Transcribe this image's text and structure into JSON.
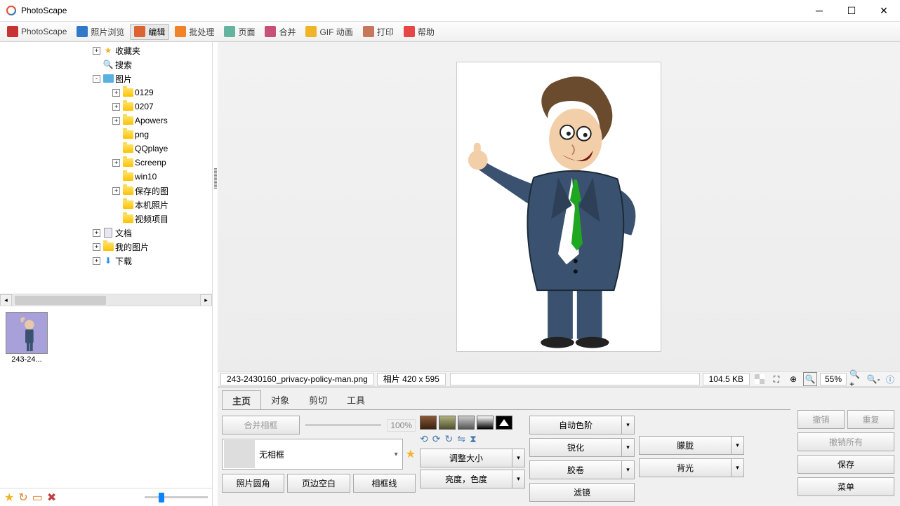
{
  "app": {
    "title": "PhotoScape"
  },
  "toolbar": {
    "items": [
      {
        "label": "PhotoScape",
        "ico": "#c83232",
        "active": false
      },
      {
        "label": "照片浏览",
        "ico": "#3278c8",
        "active": false
      },
      {
        "label": "编辑",
        "ico": "#dc6432",
        "active": true
      },
      {
        "label": "批处理",
        "ico": "#f08228",
        "active": false
      },
      {
        "label": "页面",
        "ico": "#64b4a0",
        "active": false
      },
      {
        "label": "合并",
        "ico": "#c85078",
        "active": false
      },
      {
        "label": "GIF 动画",
        "ico": "#f0b428",
        "active": false
      },
      {
        "label": "打印",
        "ico": "#c8785a",
        "active": false
      },
      {
        "label": "帮助",
        "ico": "#e64646",
        "active": false
      }
    ]
  },
  "tree": {
    "items": [
      {
        "indent": 132,
        "exp": "+",
        "icon": "star",
        "label": "收藏夹"
      },
      {
        "indent": 132,
        "exp": "",
        "icon": "search",
        "label": "搜索"
      },
      {
        "indent": 132,
        "exp": "-",
        "icon": "pics",
        "label": "图片"
      },
      {
        "indent": 160,
        "exp": "+",
        "icon": "folder",
        "label": "0129"
      },
      {
        "indent": 160,
        "exp": "+",
        "icon": "folder",
        "label": "0207"
      },
      {
        "indent": 160,
        "exp": "+",
        "icon": "folder",
        "label": "Apowers"
      },
      {
        "indent": 160,
        "exp": "",
        "icon": "folder",
        "label": "png"
      },
      {
        "indent": 160,
        "exp": "",
        "icon": "folder",
        "label": "QQplaye"
      },
      {
        "indent": 160,
        "exp": "+",
        "icon": "folder",
        "label": "Screenp"
      },
      {
        "indent": 160,
        "exp": "",
        "icon": "folder",
        "label": "win10"
      },
      {
        "indent": 160,
        "exp": "+",
        "icon": "folder",
        "label": "保存的图"
      },
      {
        "indent": 160,
        "exp": "",
        "icon": "folder",
        "label": "本机照片"
      },
      {
        "indent": 160,
        "exp": "",
        "icon": "folder",
        "label": "视频项目"
      },
      {
        "indent": 132,
        "exp": "+",
        "icon": "doc",
        "label": "文档"
      },
      {
        "indent": 132,
        "exp": "+",
        "icon": "folder",
        "label": "我的图片"
      },
      {
        "indent": 132,
        "exp": "+",
        "icon": "download",
        "label": "下载"
      }
    ]
  },
  "thumb": {
    "label": "243-24..."
  },
  "status": {
    "filename": "243-2430160_privacy-policy-man.png",
    "dims_prefix": "相片",
    "dims": "420 x 595",
    "size": "104.5 KB",
    "zoom": "55%"
  },
  "tabs": {
    "items": [
      {
        "label": "主页",
        "active": true
      },
      {
        "label": "对象",
        "active": false
      },
      {
        "label": "剪切",
        "active": false
      },
      {
        "label": "工具",
        "active": false
      }
    ]
  },
  "col1": {
    "merge_frame": "合并相框",
    "pct": "100%",
    "no_frame": "无相框",
    "round": "照片圆角",
    "margin": "页边空白",
    "frame_line": "相框线"
  },
  "col2": {
    "resize": "调整大小",
    "bright": "亮度，色度"
  },
  "col3": {
    "auto_level": "自动色阶",
    "sharpen": "锐化",
    "film": "胶卷",
    "filter": "滤镜"
  },
  "col4": {
    "blur": "朦胧",
    "backlight": "背光"
  },
  "right": {
    "undo": "撤销",
    "redo": "重复",
    "undo_all": "撤销所有",
    "save": "保存",
    "menu": "菜单"
  }
}
